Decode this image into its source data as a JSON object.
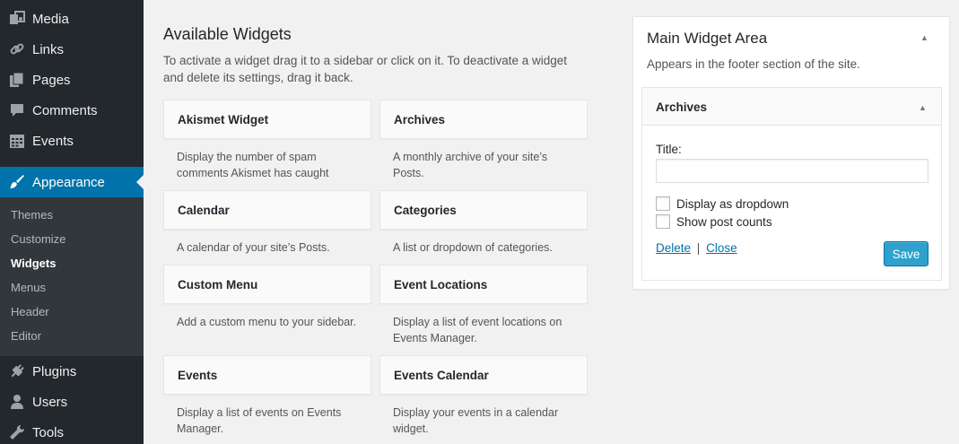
{
  "admin_menu": {
    "items_top": [
      {
        "label": "Media",
        "icon": "media-icon"
      },
      {
        "label": "Links",
        "icon": "links-icon"
      },
      {
        "label": "Pages",
        "icon": "pages-icon"
      },
      {
        "label": "Comments",
        "icon": "comments-icon"
      },
      {
        "label": "Events",
        "icon": "events-icon"
      }
    ],
    "current": {
      "label": "Appearance",
      "icon": "appearance-icon"
    },
    "submenu": [
      "Themes",
      "Customize",
      "Widgets",
      "Menus",
      "Header",
      "Editor"
    ],
    "active_submenu": "Widgets",
    "items_bottom": [
      {
        "label": "Plugins",
        "icon": "plugins-icon"
      },
      {
        "label": "Users",
        "icon": "users-icon"
      },
      {
        "label": "Tools",
        "icon": "tools-icon"
      }
    ]
  },
  "available": {
    "title": "Available Widgets",
    "description": "To activate a widget drag it to a sidebar or click on it. To deactivate a widget and delete its settings, drag it back.",
    "widgets": [
      {
        "name": "Akismet Widget",
        "desc": "Display the number of spam comments Akismet has caught"
      },
      {
        "name": "Archives",
        "desc": "A monthly archive of your site’s Posts."
      },
      {
        "name": "Calendar",
        "desc": "A calendar of your site’s Posts."
      },
      {
        "name": "Categories",
        "desc": "A list or dropdown of categories."
      },
      {
        "name": "Custom Menu",
        "desc": "Add a custom menu to your sidebar."
      },
      {
        "name": "Event Locations",
        "desc": "Display a list of event locations on Events Manager."
      },
      {
        "name": "Events",
        "desc": "Display a list of events on Events Manager."
      },
      {
        "name": "Events Calendar",
        "desc": "Display your events in a calendar widget."
      }
    ]
  },
  "main_area": {
    "title": "Main Widget Area",
    "description": "Appears in the footer section of the site.",
    "widget": {
      "title": "Archives",
      "field_label": "Title:",
      "title_value": "",
      "checkbox_dropdown": "Display as dropdown",
      "checkbox_counts": "Show post counts",
      "delete_label": "Delete",
      "separator": "|",
      "close_label": "Close",
      "save_label": "Save"
    }
  },
  "colors": {
    "menu_bg": "#23282d",
    "submenu_bg": "#32373c",
    "current_bg": "#0073aa",
    "save_bg": "#2ea2cc",
    "link": "#0073aa"
  }
}
